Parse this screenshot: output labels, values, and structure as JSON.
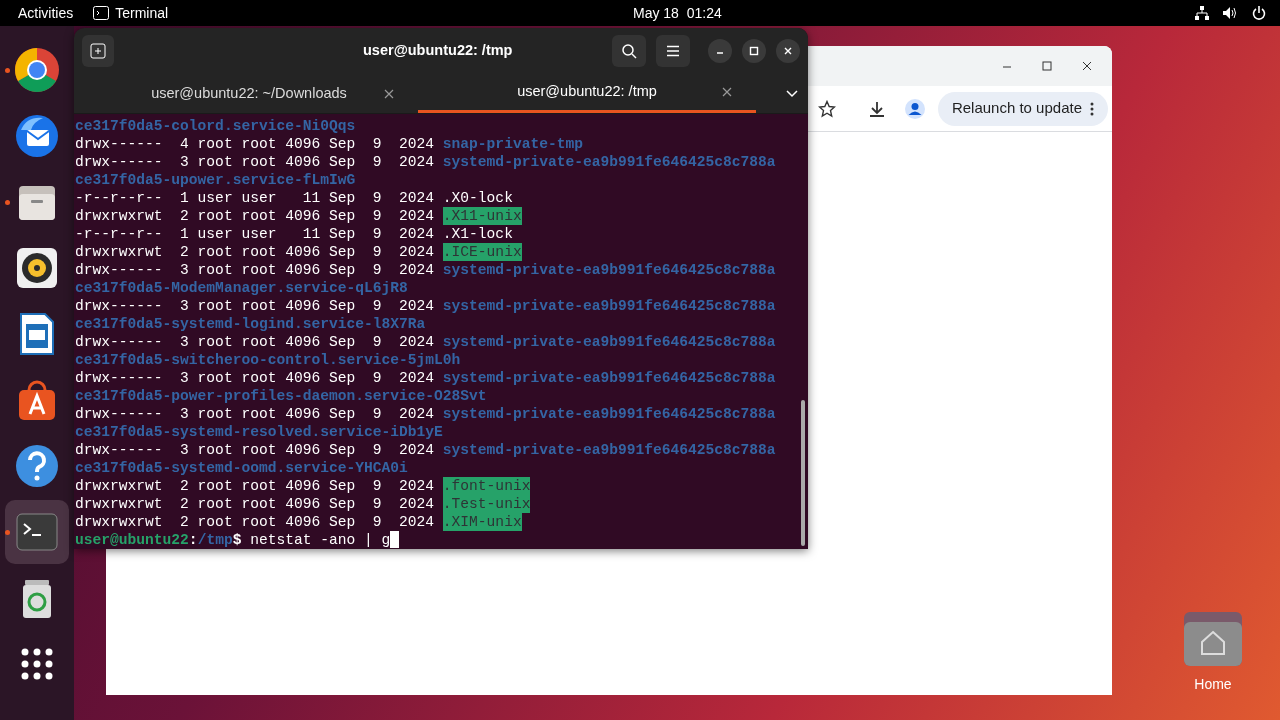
{
  "top_bar": {
    "activities": "Activities",
    "app_name": "Terminal",
    "clock": "May 18  01:24"
  },
  "dock": [
    {
      "kind": "browser",
      "running": true,
      "selected": false
    },
    {
      "kind": "mail",
      "running": false,
      "selected": false
    },
    {
      "kind": "files",
      "running": true,
      "selected": false
    },
    {
      "kind": "music",
      "running": false,
      "selected": false
    },
    {
      "kind": "writer",
      "running": false,
      "selected": false
    },
    {
      "kind": "store",
      "running": false,
      "selected": false
    },
    {
      "kind": "help",
      "running": false,
      "selected": false
    },
    {
      "kind": "terminal",
      "running": true,
      "selected": true
    },
    {
      "kind": "trash",
      "running": false,
      "selected": false
    },
    {
      "kind": "apps",
      "running": false,
      "selected": false
    }
  ],
  "browser": {
    "relaunch_button": "Relaunch to update"
  },
  "desktop_icons": [
    {
      "label": "Home"
    }
  ],
  "terminal": {
    "title": "user@ubuntu22: /tmp",
    "tabs": [
      {
        "label": "user@ubuntu22: ~/Downloads",
        "selected": false
      },
      {
        "label": "user@ubuntu22: /tmp",
        "selected": true
      }
    ],
    "lines": [
      {
        "kind": "dir",
        "name": "ce317f0da5-colord.service-Ni0Qqs"
      },
      {
        "kind": "dir",
        "prefix": "drwx------  4 root root 4096 Sep  9  2024 ",
        "name": "snap-private-tmp"
      },
      {
        "kind": "dir",
        "prefix": "drwx------  3 root root 4096 Sep  9  2024 ",
        "name": "systemd-private-ea9b991fe646425c8c788a"
      },
      {
        "kind": "dir",
        "name": "ce317f0da5-upower.service-fLmIwG"
      },
      {
        "kind": "file",
        "prefix": "-r--r--r--  1 user user   11 Sep  9  2024 ",
        "name": ".X0-lock"
      },
      {
        "kind": "sticky",
        "prefix": "drwxrwxrwt  2 root root 4096 Sep  9  2024 ",
        "name": ".X11-unix"
      },
      {
        "kind": "file",
        "prefix": "-r--r--r--  1 user user   11 Sep  9  2024 ",
        "name": ".X1-lock"
      },
      {
        "kind": "sticky",
        "prefix": "drwxrwxrwt  2 root root 4096 Sep  9  2024 ",
        "name": ".ICE-unix"
      },
      {
        "kind": "dir",
        "prefix": "drwx------  3 root root 4096 Sep  9  2024 ",
        "name": "systemd-private-ea9b991fe646425c8c788a"
      },
      {
        "kind": "dir",
        "name": "ce317f0da5-ModemManager.service-qL6jR8"
      },
      {
        "kind": "dir",
        "prefix": "drwx------  3 root root 4096 Sep  9  2024 ",
        "name": "systemd-private-ea9b991fe646425c8c788a"
      },
      {
        "kind": "dir",
        "name": "ce317f0da5-systemd-logind.service-l8X7Ra"
      },
      {
        "kind": "dir",
        "prefix": "drwx------  3 root root 4096 Sep  9  2024 ",
        "name": "systemd-private-ea9b991fe646425c8c788a"
      },
      {
        "kind": "dir",
        "name": "ce317f0da5-switcheroo-control.service-5jmL0h"
      },
      {
        "kind": "dir",
        "prefix": "drwx------  3 root root 4096 Sep  9  2024 ",
        "name": "systemd-private-ea9b991fe646425c8c788a"
      },
      {
        "kind": "dir",
        "name": "ce317f0da5-power-profiles-daemon.service-O28Svt"
      },
      {
        "kind": "dir",
        "prefix": "drwx------  3 root root 4096 Sep  9  2024 ",
        "name": "systemd-private-ea9b991fe646425c8c788a"
      },
      {
        "kind": "dir",
        "name": "ce317f0da5-systemd-resolved.service-iDb1yE"
      },
      {
        "kind": "dir",
        "prefix": "drwx------  3 root root 4096 Sep  9  2024 ",
        "name": "systemd-private-ea9b991fe646425c8c788a"
      },
      {
        "kind": "dir",
        "name": "ce317f0da5-systemd-oomd.service-YHCA0i"
      },
      {
        "kind": "sticky",
        "prefix": "drwxrwxrwt  2 root root 4096 Sep  9  2024 ",
        "name": ".font-unix"
      },
      {
        "kind": "sticky",
        "prefix": "drwxrwxrwt  2 root root 4096 Sep  9  2024 ",
        "name": ".Test-unix"
      },
      {
        "kind": "sticky",
        "prefix": "drwxrwxrwt  2 root root 4096 Sep  9  2024 ",
        "name": ".XIM-unix"
      },
      {
        "kind": "prompt",
        "user": "user@ubuntu22",
        "sep": ":",
        "path": "/tmp",
        "dollar": "$ ",
        "command": "netstat -ano | g"
      }
    ]
  }
}
